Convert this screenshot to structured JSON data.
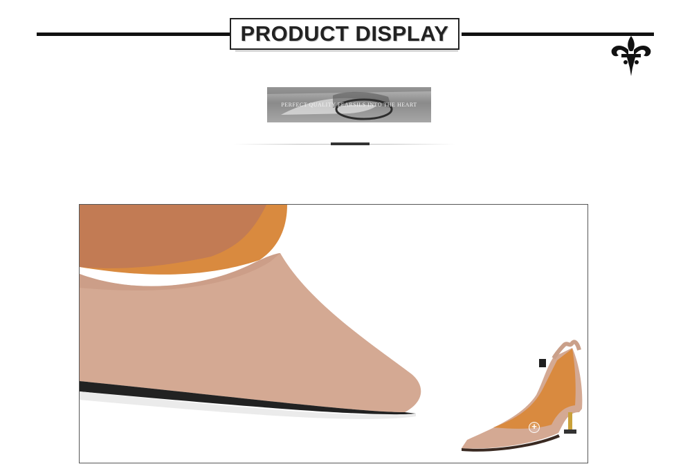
{
  "header": {
    "title": "PRODUCT DISPLAY"
  },
  "banner": {
    "text": "PERFECT QUALITY FEARSILS INTO THE HEART"
  },
  "colors": {
    "rule": "#111111",
    "suede": "#d4a993",
    "lining": "#d98a3f",
    "heel": "#c9a13a"
  },
  "icons": {
    "ornament": "fleur-de-lis-icon",
    "zoom": "zoom-plus-icon"
  }
}
